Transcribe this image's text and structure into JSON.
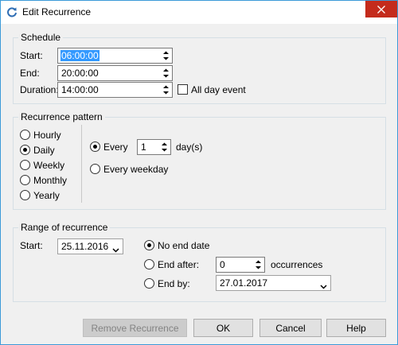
{
  "window": {
    "title": "Edit Recurrence",
    "close_icon": "close-icon",
    "app_icon": "refresh-icon"
  },
  "schedule": {
    "title": "Schedule",
    "start_label": "Start:",
    "start_value": "06:00:00",
    "end_label": "End:",
    "end_value": "20:00:00",
    "duration_label": "Duration:",
    "duration_value": "14:00:00",
    "all_day_label": "All day event",
    "all_day_checked": false
  },
  "pattern": {
    "title": "Recurrence pattern",
    "options": [
      "Hourly",
      "Daily",
      "Weekly",
      "Monthly",
      "Yearly"
    ],
    "selected": "Daily",
    "every_label": "Every",
    "every_value": "1",
    "unit_label": "day(s)",
    "every_weekday_label": "Every weekday",
    "daily_selected": "Every"
  },
  "range": {
    "title": "Range of recurrence",
    "start_label": "Start:",
    "start_value": "25.11.2016",
    "no_end_label": "No end date",
    "end_after_label": "End after:",
    "end_after_value": "0",
    "occurrences_label": "occurrences",
    "end_by_label": "End by:",
    "end_by_value": "27.01.2017",
    "selected": "No end date"
  },
  "buttons": {
    "remove": "Remove Recurrence",
    "ok": "OK",
    "cancel": "Cancel",
    "help": "Help"
  },
  "colors": {
    "accent": "#3c9ad8",
    "close": "#c42b1c",
    "selection": "#3399ff"
  }
}
